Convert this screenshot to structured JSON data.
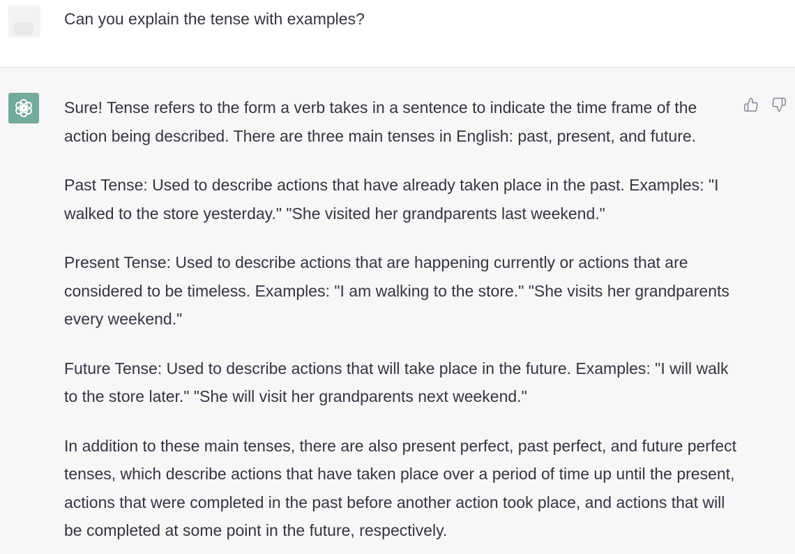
{
  "user_message": {
    "text": "Can you explain the tense with examples?"
  },
  "assistant_message": {
    "paragraphs": [
      "Sure! Tense refers to the form a verb takes in a sentence to indicate the time frame of the action being described. There are three main tenses in English: past, present, and future.",
      "Past Tense: Used to describe actions that have already taken place in the past. Examples: \"I walked to the store yesterday.\" \"She visited her grandparents last weekend.\"",
      "Present Tense: Used to describe actions that are happening currently or actions that are considered to be timeless. Examples: \"I am walking to the store.\" \"She visits her grandparents every weekend.\"",
      "Future Tense: Used to describe actions that will take place in the future. Examples: \"I will walk to the store later.\" \"She will visit her grandparents next weekend.\"",
      "In addition to these main tenses, there are also present perfect, past perfect, and future perfect tenses, which describe actions that have taken place over a period of time up until the present, actions that were completed in the past before another action took place, and actions that will be completed at some point in the future, respectively."
    ]
  },
  "icons": {
    "avatar": "openai-logo-icon",
    "like": "thumbs-up-icon",
    "dislike": "thumbs-down-icon"
  },
  "colors": {
    "assistant_bg": "#f7f7f8",
    "avatar_bg": "#74aa9c",
    "text": "#343541",
    "icon": "#8e8ea0"
  }
}
